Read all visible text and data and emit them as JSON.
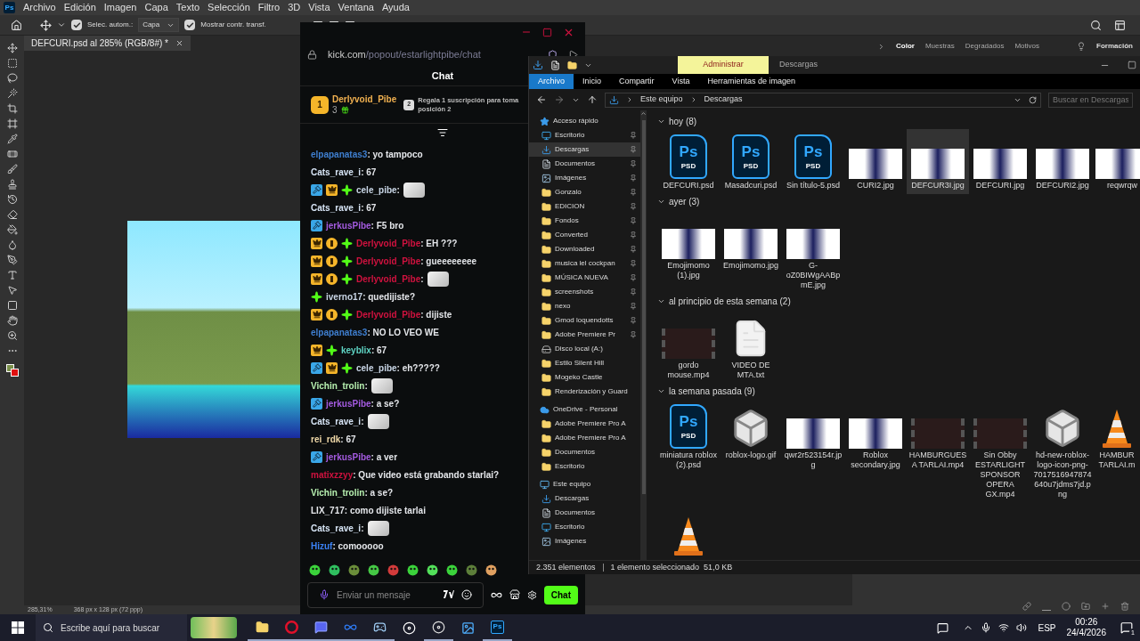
{
  "photoshop": {
    "logo": "Ps",
    "menu": [
      "Archivo",
      "Edición",
      "Imagen",
      "Capa",
      "Texto",
      "Selección",
      "Filtro",
      "3D",
      "Vista",
      "Ventana",
      "Ayuda"
    ],
    "options": {
      "auto_select": {
        "label": "Selec. autom.:",
        "checked": true
      },
      "auto_select_target": "Capa",
      "transform_controls": {
        "label": "Mostrar contr. transf.",
        "checked": true
      }
    },
    "document_tab": "DEFCURI.psd al 285% (RGB/8#) *",
    "panel_tabs": [
      {
        "label": "Color",
        "selected": true
      },
      {
        "label": "Muestras",
        "selected": false
      },
      {
        "label": "Degradados",
        "selected": false
      },
      {
        "label": "Motivos",
        "selected": false
      }
    ],
    "learn_tab": "Formación",
    "zoom": "285,31%",
    "doc_size": "368 px x 128 px (72 ppp)"
  },
  "chat": {
    "url_host": "kick.com",
    "url_path": "/popout/estarlightpibe/chat",
    "title": "Chat",
    "leaderboard": {
      "rank": "1",
      "user": "Derlyvoid_Pibe",
      "gifts": "3",
      "next_rank": "2",
      "prompt_lines": [
        "Regala 1 suscripción para toma",
        "posición 2"
      ]
    },
    "messages": [
      {
        "user": "elpapanatas3",
        "color": "#3f7fd0",
        "kind": "text",
        "text": ": yo tampoco"
      },
      {
        "user": "Cats_rave_i",
        "color": "#d6e4f5",
        "kind": "text",
        "text": ": 67"
      },
      {
        "user": "cele_pibe",
        "color": "#c9d6e6",
        "badges": [
          {
            "kind": "mod"
          },
          {
            "kind": "crown"
          },
          {
            "kind": "sparkle"
          }
        ],
        "kind": "emote",
        "text": ":"
      },
      {
        "user": "Cats_rave_i",
        "color": "#d6e4f5",
        "kind": "text",
        "text": ": 67"
      },
      {
        "user": "jerkusPibe",
        "color": "#a45be0",
        "badges": [
          {
            "kind": "mod"
          }
        ],
        "kind": "text",
        "text": ": F5 bro"
      },
      {
        "user": "Derlyvoid_Pibe",
        "color": "#d1123f",
        "badges": [
          {
            "kind": "crown"
          },
          {
            "kind": "sub"
          },
          {
            "kind": "sparkle"
          }
        ],
        "kind": "text",
        "text": ": EH ???"
      },
      {
        "user": "Derlyvoid_Pibe",
        "color": "#d1123f",
        "badges": [
          {
            "kind": "crown"
          },
          {
            "kind": "sub"
          },
          {
            "kind": "sparkle"
          }
        ],
        "kind": "text",
        "text": ": gueeeeeeee"
      },
      {
        "user": "Derlyvoid_Pibe",
        "color": "#d1123f",
        "badges": [
          {
            "kind": "crown"
          },
          {
            "kind": "sub"
          },
          {
            "kind": "sparkle"
          }
        ],
        "kind": "emote",
        "text": ":"
      },
      {
        "user": "iverno17",
        "color": "#c9d6e6",
        "badges": [
          {
            "kind": "sparkle"
          }
        ],
        "kind": "text",
        "text": ": quedijiste?"
      },
      {
        "user": "Derlyvoid_Pibe",
        "color": "#d1123f",
        "badges": [
          {
            "kind": "crown"
          },
          {
            "kind": "sub"
          },
          {
            "kind": "sparkle"
          }
        ],
        "kind": "text",
        "text": ": dijiste"
      },
      {
        "user": "elpapanatas3",
        "color": "#3f7fd0",
        "kind": "text",
        "text": ": NO LO VEO WE"
      },
      {
        "user": "keyblix",
        "color": "#5fd4c4",
        "badges": [
          {
            "kind": "crown"
          },
          {
            "kind": "sparkle"
          }
        ],
        "kind": "text",
        "text": ": 67"
      },
      {
        "user": "cele_pibe",
        "color": "#c9d6e6",
        "badges": [
          {
            "kind": "mod"
          },
          {
            "kind": "crown"
          },
          {
            "kind": "sparkle"
          }
        ],
        "kind": "text",
        "text": ": eh?????"
      },
      {
        "user": "Vichin_trolin",
        "color": "#b7f0b0",
        "kind": "emote",
        "text": ":"
      },
      {
        "user": "jerkusPibe",
        "color": "#a45be0",
        "badges": [
          {
            "kind": "mod"
          }
        ],
        "kind": "text",
        "text": ": a se?"
      },
      {
        "user": "Cats_rave_i",
        "color": "#d6e4f5",
        "kind": "emote",
        "text": ":"
      },
      {
        "user": "rei_rdk",
        "color": "#f0d9a8",
        "kind": "text",
        "text": ": 67"
      },
      {
        "user": "jerkusPibe",
        "color": "#a45be0",
        "badges": [
          {
            "kind": "mod"
          }
        ],
        "kind": "text",
        "text": ": a ver"
      },
      {
        "user": "matixzzyy",
        "color": "#d1123f",
        "kind": "text",
        "text": ": Que video está grabando starlai?"
      },
      {
        "user": "Vichin_trolin",
        "color": "#b7f0b0",
        "kind": "text",
        "text": ": a se?"
      },
      {
        "user": "LIX_717",
        "color": "#e5e7eb",
        "kind": "text",
        "text": ": como dijiste tarlai"
      },
      {
        "user": "Cats_rave_i",
        "color": "#d6e4f5",
        "kind": "emote",
        "text": ":"
      },
      {
        "user": "Hizuf",
        "color": "#3b82f6",
        "kind": "text",
        "text": ": comooooo"
      }
    ],
    "input": {
      "placeholder": "Enviar un mensaje"
    },
    "send_button": "Chat"
  },
  "explorer": {
    "ribbon_context": "Administrar",
    "window_title": "Descargas",
    "ribbon_tabs": [
      {
        "label": "Archivo",
        "selected": true
      },
      {
        "label": "Inicio",
        "selected": false
      },
      {
        "label": "Compartir",
        "selected": false
      },
      {
        "label": "Vista",
        "selected": false
      },
      {
        "label": "Herramientas de imagen",
        "selected": false
      }
    ],
    "breadcrumb": [
      "Este equipo",
      "Descargas"
    ],
    "search": {
      "placeholder": "Buscar en Descargas"
    },
    "nav": [
      {
        "label": "Acceso rápido",
        "kind": "star",
        "children": [
          {
            "label": "Escritorio",
            "kind": "desktop",
            "pinned": true,
            "selected": false
          },
          {
            "label": "Descargas",
            "kind": "download",
            "pinned": true,
            "selected": true
          },
          {
            "label": "Documentos",
            "kind": "document",
            "pinned": true,
            "selected": false
          },
          {
            "label": "Imágenes",
            "kind": "pictures",
            "pinned": true,
            "selected": false
          },
          {
            "label": "Gonzalo",
            "kind": "folder",
            "pinned": true,
            "selected": false
          },
          {
            "label": "EDICION",
            "kind": "folder",
            "pinned": true,
            "selected": false
          },
          {
            "label": "Fondos",
            "kind": "folder",
            "pinned": true,
            "selected": false
          },
          {
            "label": "Converted",
            "kind": "folder",
            "pinned": true,
            "selected": false
          },
          {
            "label": "Downloaded",
            "kind": "folder",
            "pinned": true,
            "selected": false
          },
          {
            "label": "musica lel cockpan",
            "kind": "folder",
            "pinned": true,
            "selected": false
          },
          {
            "label": "MÚSICA NUEVA",
            "kind": "folder",
            "pinned": true,
            "selected": false
          },
          {
            "label": "screenshots",
            "kind": "folder",
            "pinned": true,
            "selected": false
          },
          {
            "label": "nexo",
            "kind": "folder",
            "pinned": true,
            "selected": false
          },
          {
            "label": "Gmod loquendotts",
            "kind": "folder",
            "pinned": true,
            "selected": false
          },
          {
            "label": "Adobe Premiere Pr",
            "kind": "folder",
            "pinned": true,
            "selected": false
          },
          {
            "label": "Disco local (A:)",
            "kind": "drive",
            "pinned": false,
            "selected": false
          },
          {
            "label": "Estilo Silent Hill",
            "kind": "folder",
            "pinned": false,
            "selected": false
          },
          {
            "label": "Mogeko Castle",
            "kind": "folder",
            "pinned": false,
            "selected": false
          },
          {
            "label": "Renderización y Guard",
            "kind": "folder",
            "pinned": false,
            "selected": false
          }
        ]
      },
      {
        "label": "OneDrive - Personal",
        "kind": "cloud",
        "children": [
          {
            "label": "Adobe Premiere Pro A",
            "kind": "folder",
            "pinned": false,
            "selected": false
          },
          {
            "label": "Adobe Premiere Pro A",
            "kind": "folder",
            "pinned": false,
            "selected": false
          },
          {
            "label": "Documentos",
            "kind": "folder",
            "pinned": false,
            "selected": false
          },
          {
            "label": "Escritorio",
            "kind": "folder",
            "pinned": false,
            "selected": false
          }
        ]
      },
      {
        "label": "Este equipo",
        "kind": "computer",
        "children": [
          {
            "label": "Descargas",
            "kind": "download",
            "pinned": false,
            "selected": false
          },
          {
            "label": "Documentos",
            "kind": "document",
            "pinned": false,
            "selected": false
          },
          {
            "label": "Escritorio",
            "kind": "desktop",
            "pinned": false,
            "selected": false
          },
          {
            "label": "Imágenes",
            "kind": "pictures",
            "pinned": false,
            "selected": false
          }
        ]
      }
    ],
    "groups": [
      {
        "title": "hoy (8)",
        "expanded": true,
        "files": [
          {
            "name": "DEFCURI.psd",
            "kind": "psd",
            "icon_text": [
              "Ps",
              "PSD"
            ],
            "selected": false
          },
          {
            "name": "Masadcuri.psd",
            "kind": "psd",
            "icon_text": [
              "Ps",
              "PSD"
            ],
            "selected": false
          },
          {
            "name": "Sin título-5.psd",
            "kind": "psd",
            "icon_text": [
              "Ps",
              "PSD"
            ],
            "selected": false
          },
          {
            "name": "CURI2.jpg",
            "kind": "image",
            "selected": false
          },
          {
            "name": "DEFCUR3I.jpg",
            "kind": "image",
            "selected": true
          },
          {
            "name": "DEFCURI.jpg",
            "kind": "image",
            "selected": false
          },
          {
            "name": "DEFCURI2.jpg",
            "kind": "image",
            "selected": false
          },
          {
            "name": "reqwrqw",
            "kind": "image",
            "selected": false
          }
        ]
      },
      {
        "title": "ayer (3)",
        "expanded": true,
        "files": [
          {
            "name": "Emojimomo (1).jpg",
            "kind": "image",
            "selected": false
          },
          {
            "name": "Emojimomo.jpg",
            "kind": "image",
            "selected": false
          },
          {
            "name": "G-oZ0BIWgAABpmE.jpg",
            "kind": "image",
            "selected": false
          }
        ]
      },
      {
        "title": "al principio de esta semana (2)",
        "expanded": true,
        "files": [
          {
            "name": "gordo mouse.mp4",
            "kind": "video",
            "selected": false
          },
          {
            "name": "VIDEO DE MTA.txt",
            "kind": "text",
            "selected": false
          }
        ]
      },
      {
        "title": "la semana pasada (9)",
        "expanded": true,
        "files": [
          {
            "name": "miniatura roblox (2).psd",
            "kind": "psd",
            "icon_text": [
              "Ps",
              "PSD"
            ],
            "selected": false
          },
          {
            "name": "roblox-logo.gif",
            "kind": "logo",
            "selected": false
          },
          {
            "name": "qwr2r523154r.jpg",
            "kind": "image",
            "selected": false
          },
          {
            "name": "Roblox secondary.jpg",
            "kind": "image",
            "selected": false
          },
          {
            "name": "HAMBURGUESA TARLAI.mp4",
            "kind": "video",
            "selected": false
          },
          {
            "name": "Sin Obby ESTARLIGHT SPONSOR OPERA GX.mp4",
            "kind": "video",
            "selected": false
          },
          {
            "name": "hd-new-roblox-logo-icon-png-7017516947874640u7jdms7jd.png",
            "kind": "logo",
            "selected": false
          },
          {
            "name": "HAMBUR TARLAI.m",
            "kind": "cone",
            "selected": false
          },
          {
            "kind": "cone",
            "selected": false
          }
        ]
      }
    ],
    "status": [
      "2.351 elementos",
      "1 elemento seleccionado  51,0 KB"
    ]
  },
  "taskbar": {
    "search_placeholder": "Escribe aquí para buscar",
    "ps_logo": "Ps",
    "language": "ESP",
    "time": "00:26",
    "date": "24/4/2026",
    "notification_count": "1"
  }
}
